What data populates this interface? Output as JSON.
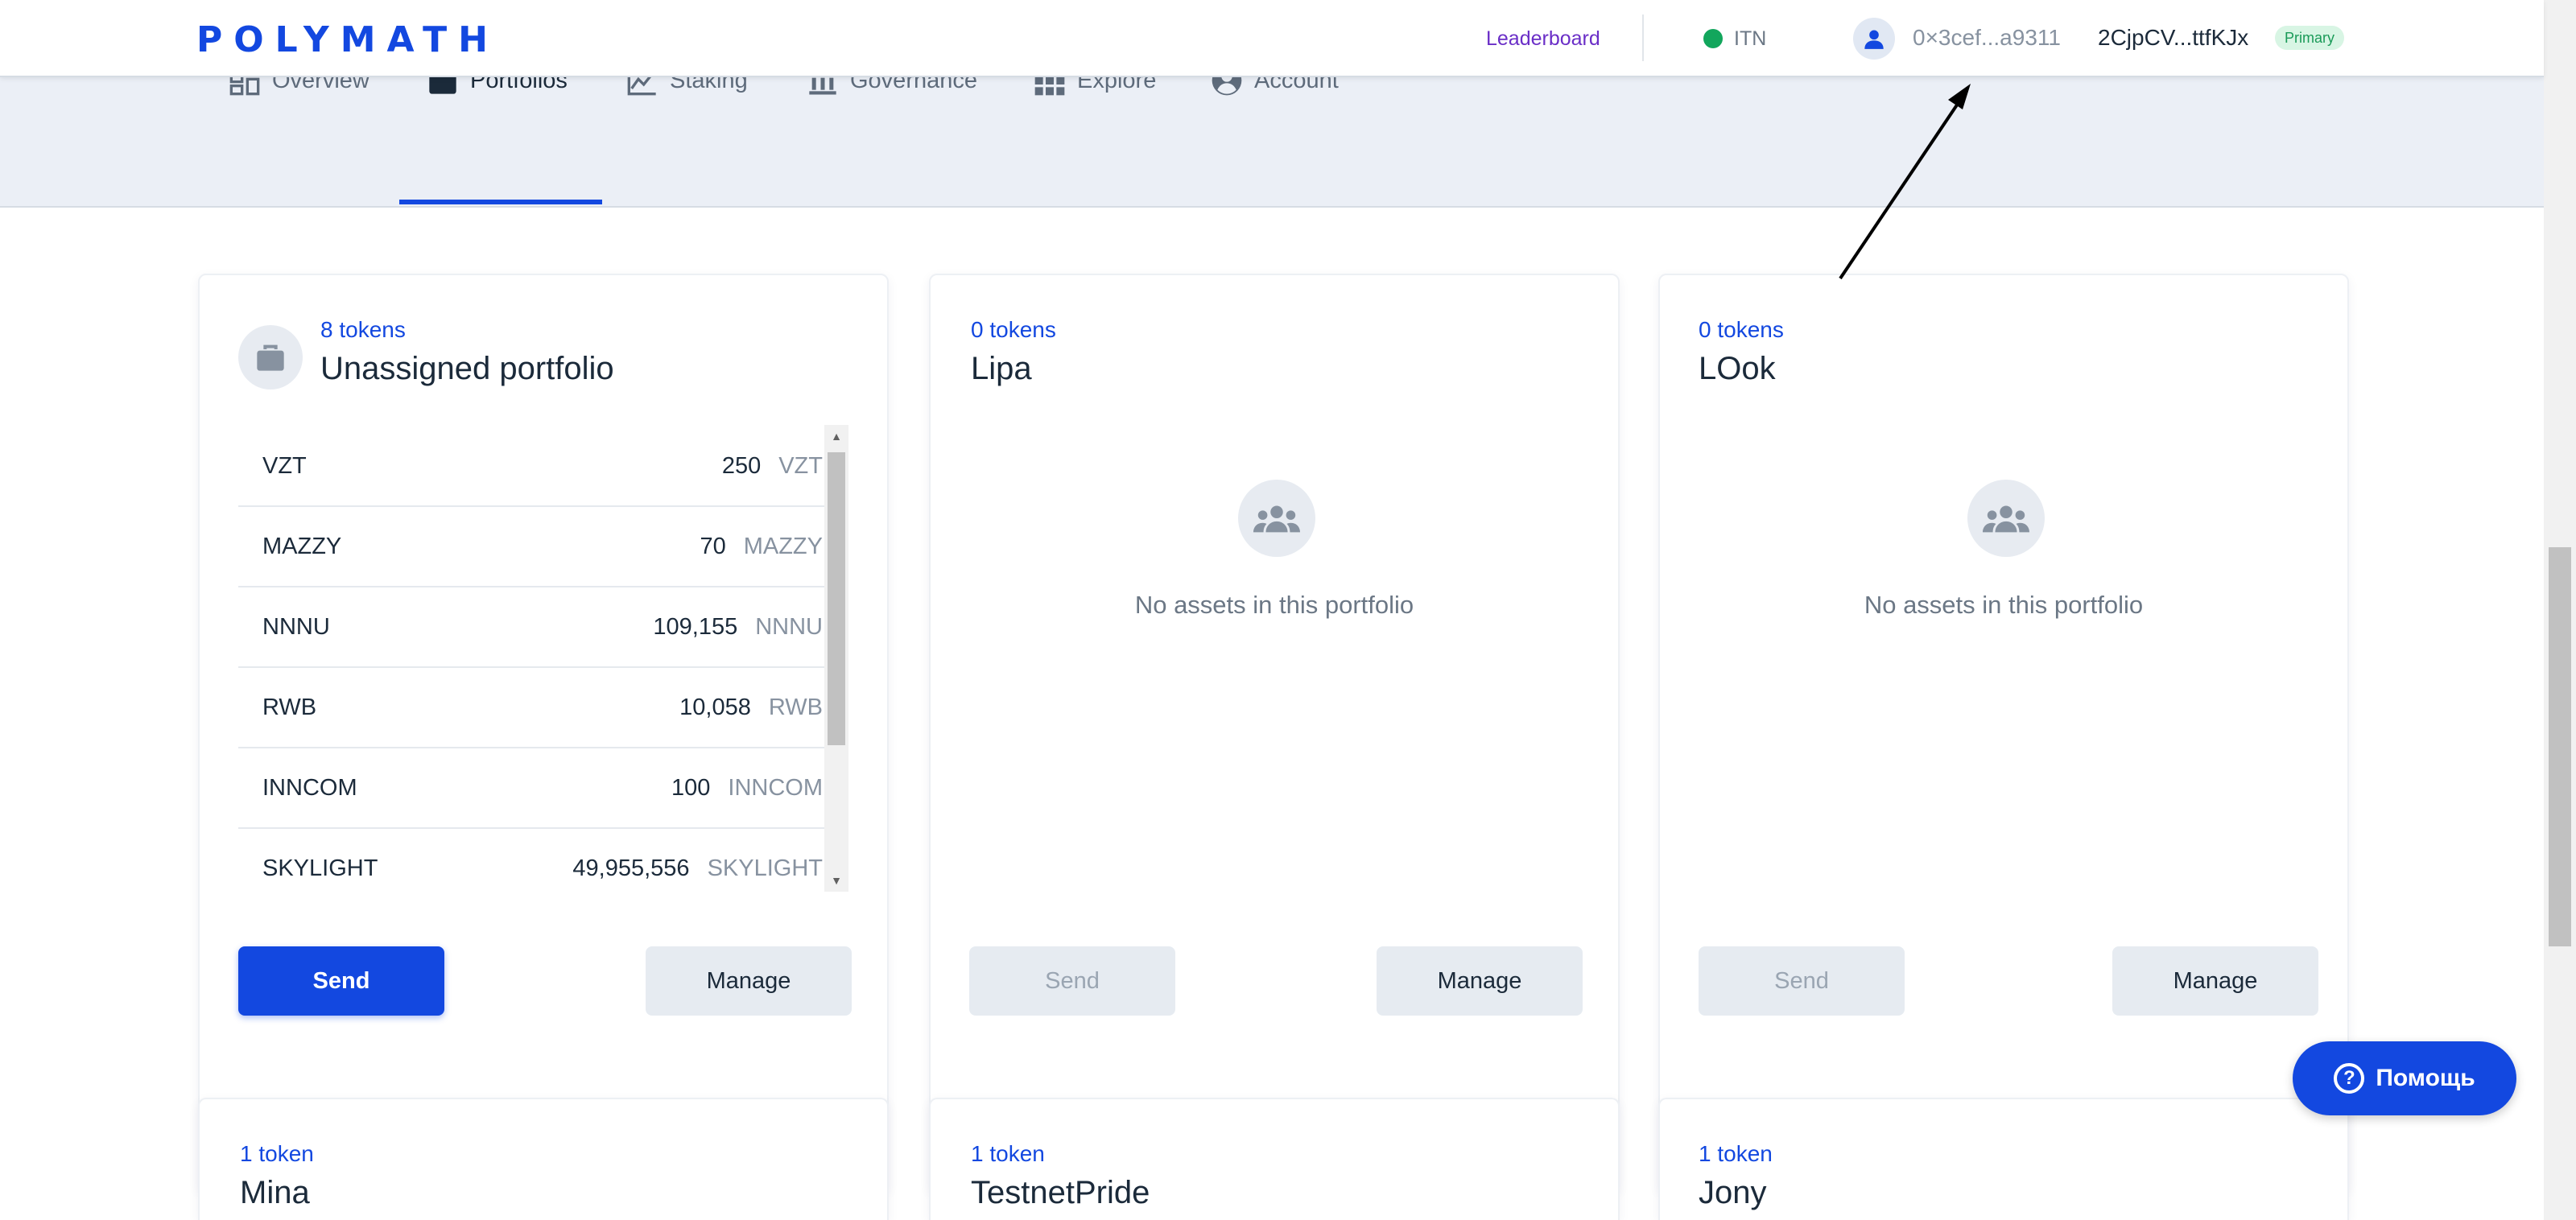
{
  "header": {
    "logo": "POLYMATH",
    "leaderboard": "Leaderboard",
    "network": "ITN",
    "address": "0×3cef...a9311",
    "key_id": "2CjpCV...ttfKJx",
    "badge": "Primary"
  },
  "nav": {
    "tabs": [
      {
        "label": "Overview",
        "icon": "overview-grid-icon"
      },
      {
        "label": "Portfolios",
        "icon": "briefcase-icon",
        "active": true
      },
      {
        "label": "Staking",
        "icon": "line-chart-icon"
      },
      {
        "label": "Governance",
        "icon": "bank-icon"
      },
      {
        "label": "Explore",
        "icon": "apps-grid-icon"
      },
      {
        "label": "Account",
        "icon": "user-circle-icon"
      }
    ]
  },
  "portfolios": [
    {
      "count": "8 tokens",
      "name": "Unassigned portfolio",
      "assets": [
        {
          "ticker": "VZT",
          "amount": "250",
          "unit": "VZT"
        },
        {
          "ticker": "MAZZY",
          "amount": "70",
          "unit": "MAZZY"
        },
        {
          "ticker": "NNNU",
          "amount": "109,155",
          "unit": "NNNU"
        },
        {
          "ticker": "RWB",
          "amount": "10,058",
          "unit": "RWB"
        },
        {
          "ticker": "INNCOM",
          "amount": "100",
          "unit": "INNCOM"
        },
        {
          "ticker": "SKYLIGHT",
          "amount": "49,955,556",
          "unit": "SKYLIGHT"
        }
      ],
      "send": "Send",
      "manage": "Manage"
    },
    {
      "count": "0 tokens",
      "name": "Lipa",
      "empty": "No assets in this portfolio",
      "send": "Send",
      "manage": "Manage"
    },
    {
      "count": "0 tokens",
      "name": "LOok",
      "empty": "No assets in this portfolio",
      "send": "Send",
      "manage": "Manage"
    },
    {
      "count": "1 token",
      "name": "Mina"
    },
    {
      "count": "1 token",
      "name": "TestnetPride"
    },
    {
      "count": "1 token",
      "name": "Jony"
    }
  ],
  "help": {
    "label": "Помощь",
    "icon": "?"
  },
  "colors": {
    "accent": "#1348e0",
    "leaderboard": "#6a2ec7",
    "network_ok": "#12a65c"
  }
}
